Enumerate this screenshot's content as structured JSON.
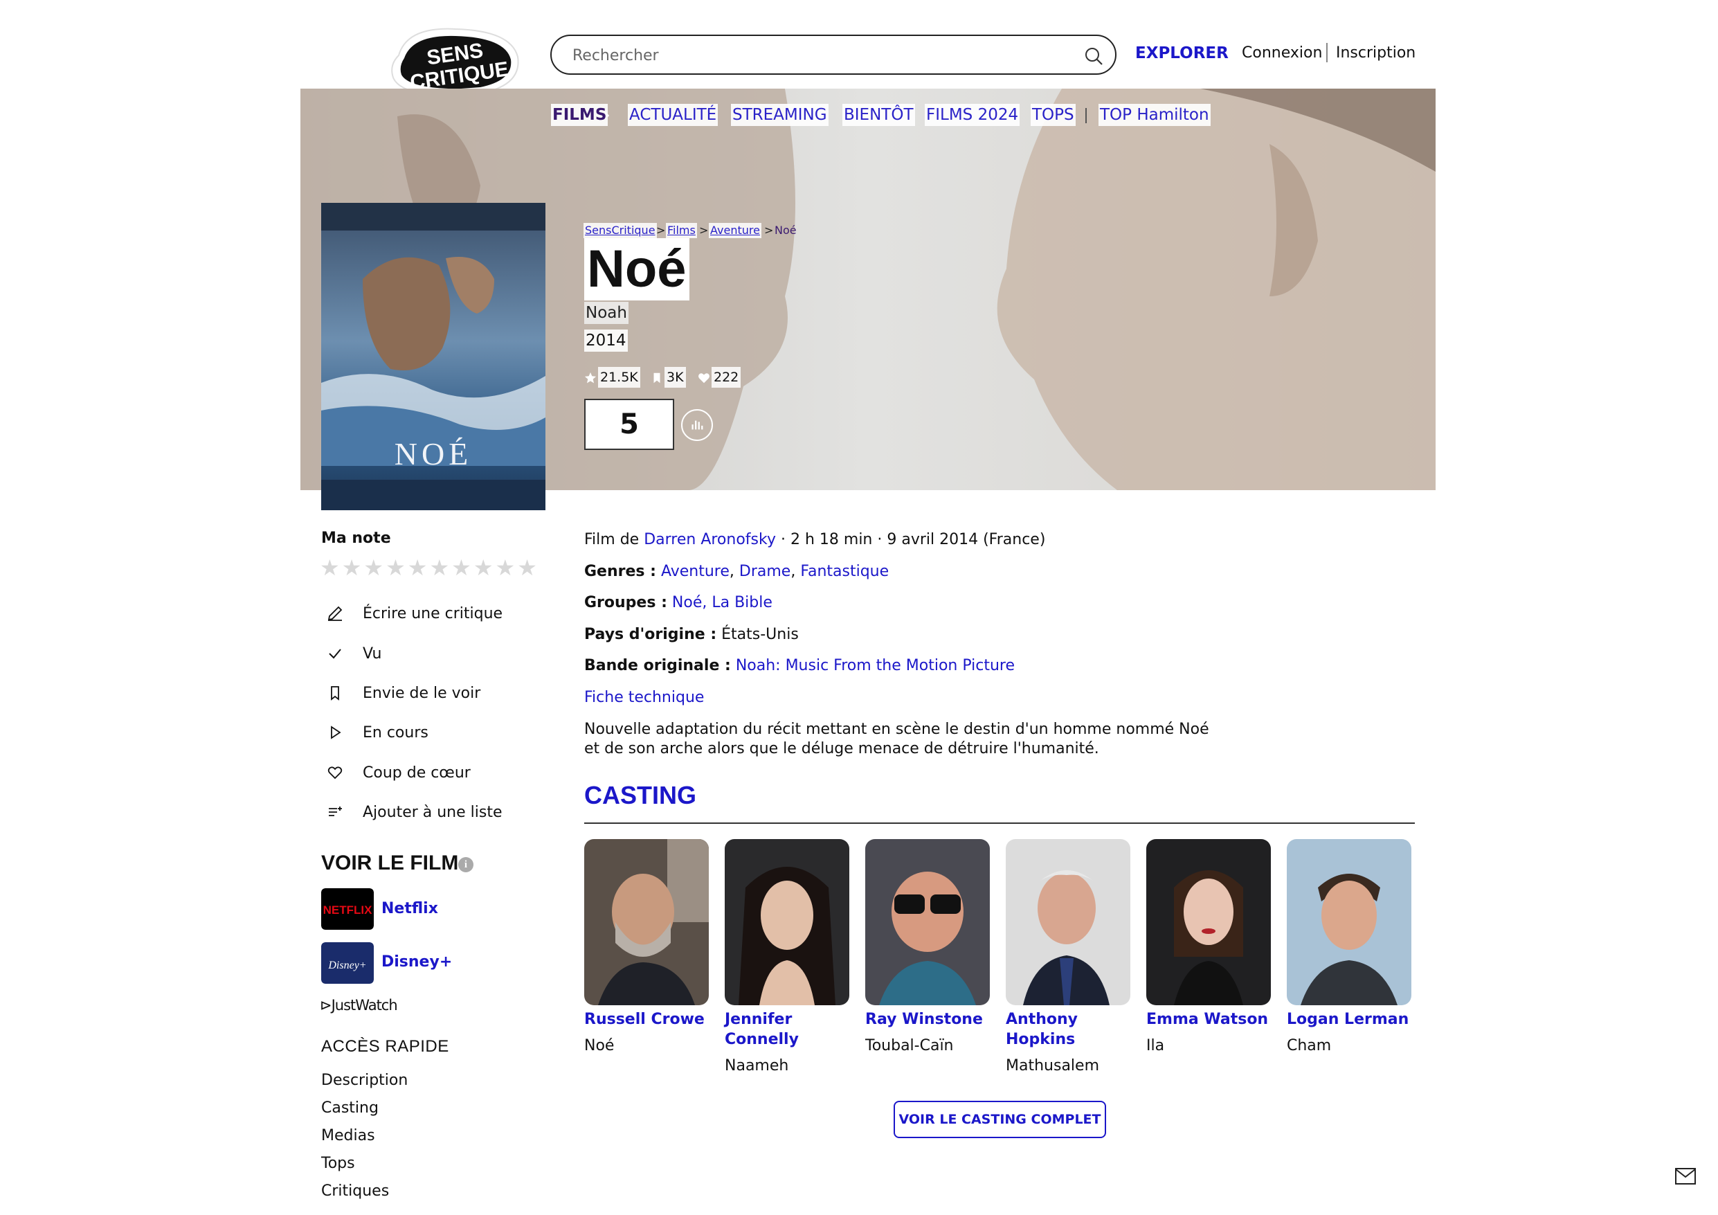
{
  "brand": {
    "logo_line1": "SENS",
    "logo_line2": "CRITIQUE"
  },
  "search": {
    "placeholder": "Rechercher"
  },
  "header": {
    "explorer": "EXPLORER",
    "login": "Connexion",
    "signup": "Inscription"
  },
  "menu": [
    "FILMS",
    "ACTUALITÉ",
    "STREAMING",
    "BIENTÔT",
    "FILMS 2024",
    "TOPS",
    "TOP Hamilton"
  ],
  "breadcrumb": [
    "SensCritique",
    "Films",
    "Aventure",
    "Noé"
  ],
  "movie": {
    "title": "Noé",
    "original_title": "Noah",
    "year": "2014",
    "ratings_count": "21.5K",
    "wishlist_count": "3K",
    "favorites_count": "222",
    "score": "5",
    "poster_title": "NOÉ"
  },
  "my_rating": {
    "label": "Ma note",
    "max": 10
  },
  "actions": [
    "Écrire une critique",
    "Vu",
    "Envie de le voir",
    "En cours",
    "Coup de cœur",
    "Ajouter à une liste"
  ],
  "watch": {
    "title": "VOIR LE FILM",
    "providers": [
      {
        "name": "Netflix",
        "logo_text": "NETFLIX",
        "color": "#000000",
        "accent": "#e50914"
      },
      {
        "name": "Disney+",
        "logo_text": "Disney+",
        "color": "#1a2c6b",
        "accent": "#ffffff"
      }
    ],
    "justwatch": "JustWatch"
  },
  "quick_access": {
    "title": "ACCÈS RAPIDE",
    "items": [
      "Description",
      "Casting",
      "Medias",
      "Tops",
      "Critiques"
    ]
  },
  "details": {
    "film_by_label": "Film de",
    "director": "Darren Aronofsky",
    "duration_release": "· 2 h 18 min · 9 avril 2014 (France)",
    "genres_label": "Genres :",
    "genres": [
      "Aventure",
      "Drame",
      "Fantastique"
    ],
    "groups_label": "Groupes :",
    "groups": "Noé, La Bible",
    "country_label": "Pays d'origine :",
    "country": "États-Unis",
    "soundtrack_label": "Bande originale :",
    "soundtrack": "Noah: Music From the Motion Picture",
    "tech_sheet": "Fiche technique",
    "synopsis": "Nouvelle adaptation du récit mettant en scène le destin d'un homme nommé Noé et de son arche alors que le déluge menace de détruire l'humanité."
  },
  "casting": {
    "title": "CASTING",
    "cast": [
      {
        "name": "Russell Crowe",
        "role": "Noé"
      },
      {
        "name": "Jennifer Connelly",
        "role": "Naameh"
      },
      {
        "name": "Ray Winstone",
        "role": "Toubal-Caïn"
      },
      {
        "name": "Anthony Hopkins",
        "role": "Mathusalem"
      },
      {
        "name": "Emma Watson",
        "role": "Ila"
      },
      {
        "name": "Logan Lerman",
        "role": "Cham"
      }
    ],
    "full_cast_button": "VOIR LE CASTING COMPLET"
  },
  "colors": {
    "link": "#1b17c9",
    "nav_active": "#3a1a70",
    "star_empty": "#d8d8d8"
  }
}
